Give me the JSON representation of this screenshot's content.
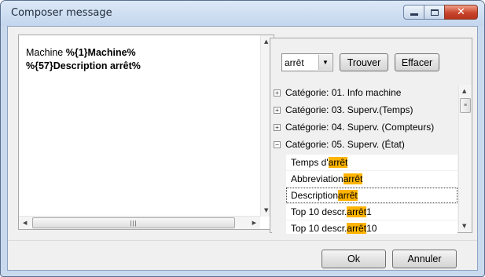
{
  "window": {
    "title": "Composer  message",
    "controls": {
      "minimize": "minimize",
      "maximize": "maximize",
      "close": "✕"
    }
  },
  "message": {
    "prefix": "Machine ",
    "token1": "%{1}Machine%",
    "line2": "%{57}Description arrêt%"
  },
  "search": {
    "value": "arrêt",
    "find_label": "Trouver",
    "clear_label": "Effacer"
  },
  "tree": {
    "categories": [
      {
        "expander": "+",
        "label": "Catégorie: 01.  Info machine"
      },
      {
        "expander": "+",
        "label": "Catégorie: 03. Superv.(Temps)"
      },
      {
        "expander": "+",
        "label": "Catégorie: 04. Superv. (Compteurs)"
      },
      {
        "expander": "−",
        "label": "Catégorie: 05. Superv. (État)"
      }
    ],
    "items": [
      {
        "pre": "Temps d'",
        "hl": "arrêt",
        "post": ""
      },
      {
        "pre": "Abbreviation ",
        "hl": "arrêt",
        "post": ""
      },
      {
        "pre": "Description ",
        "hl": "arrêt",
        "post": ""
      },
      {
        "pre": "Top 10 descr. ",
        "hl": "arrêt",
        "post": " 1"
      },
      {
        "pre": "Top 10 descr. ",
        "hl": "arrêt",
        "post": " 10"
      }
    ]
  },
  "buttons": {
    "ok": "Ok",
    "cancel": "Annuler"
  },
  "colors": {
    "highlight": "#ffb400",
    "title_bg": "#c9daee",
    "close": "#c9452c"
  }
}
